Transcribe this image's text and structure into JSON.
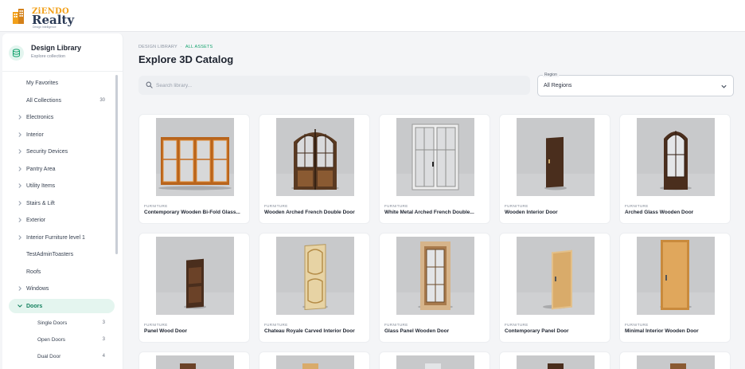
{
  "brand": {
    "name_top": "ZiENDO",
    "name_bottom": "Realty",
    "tagline": "Design Intelligence",
    "accent": "#f2a01a"
  },
  "sidebar": {
    "title": "Design Library",
    "subtitle": "Explore collection",
    "items": [
      {
        "label": "My Favorites",
        "chevron": false
      },
      {
        "label": "All Collections",
        "count": "30",
        "chevron": false
      },
      {
        "label": "Electronics",
        "chevron": true
      },
      {
        "label": "Interior",
        "chevron": true
      },
      {
        "label": "Security Devices",
        "chevron": true
      },
      {
        "label": "Pantry Area",
        "chevron": true
      },
      {
        "label": "Utility Items",
        "chevron": true
      },
      {
        "label": "Stairs & Lift",
        "chevron": true
      },
      {
        "label": "Exterior",
        "chevron": true
      },
      {
        "label": "Interior Furniture level 1",
        "chevron": true
      },
      {
        "label": "TestAdminToasters",
        "chevron": false
      },
      {
        "label": "Roofs",
        "chevron": false
      },
      {
        "label": "Windows",
        "chevron": true
      },
      {
        "label": "Doors",
        "chevron": true,
        "active": true
      },
      {
        "label": "Single Doors",
        "count": "3",
        "sub": true
      },
      {
        "label": "Open Doors",
        "count": "3",
        "sub": true
      },
      {
        "label": "Dual Door",
        "count": "4",
        "sub": true
      }
    ]
  },
  "breadcrumb": {
    "root": "DESIGN LIBRARY",
    "separator": "·",
    "current": "ALL ASSETS"
  },
  "page_title": "Explore 3D Catalog",
  "search": {
    "placeholder": "Search library...",
    "value": ""
  },
  "region": {
    "label": "Region",
    "value": "All Regions"
  },
  "cards": [
    {
      "category": "FURNITURE",
      "name": "Contemporary Wooden Bi-Fold Glass...",
      "door": "bifold"
    },
    {
      "category": "FURNITURE",
      "name": "Wooden Arched French Double Door",
      "door": "arched-double"
    },
    {
      "category": "FURNITURE",
      "name": "White Metal Arched French Double...",
      "door": "white-double"
    },
    {
      "category": "FURNITURE",
      "name": "Wooden Interior Door",
      "door": "dark-single"
    },
    {
      "category": "FURNITURE",
      "name": "Arched Glass Wooden Door",
      "door": "arched-glass"
    },
    {
      "category": "FURNITURE",
      "name": "Panel Wood Door",
      "door": "panel-dark"
    },
    {
      "category": "FURNITURE",
      "name": "Chateau Royale Carved Interior Door",
      "door": "carved"
    },
    {
      "category": "FURNITURE",
      "name": "Glass Panel Wooden Door",
      "door": "glass-panel"
    },
    {
      "category": "FURNITURE",
      "name": "Contemporary Panel Door",
      "door": "contemporary"
    },
    {
      "category": "FURNITURE",
      "name": "Minimal Interior Wooden Door",
      "door": "minimal"
    }
  ],
  "partial_row_count": 5,
  "colors": {
    "accent_green": "#14a36e",
    "active_bg": "#e4f5ef",
    "thumb_bg": "#c9cacc"
  }
}
